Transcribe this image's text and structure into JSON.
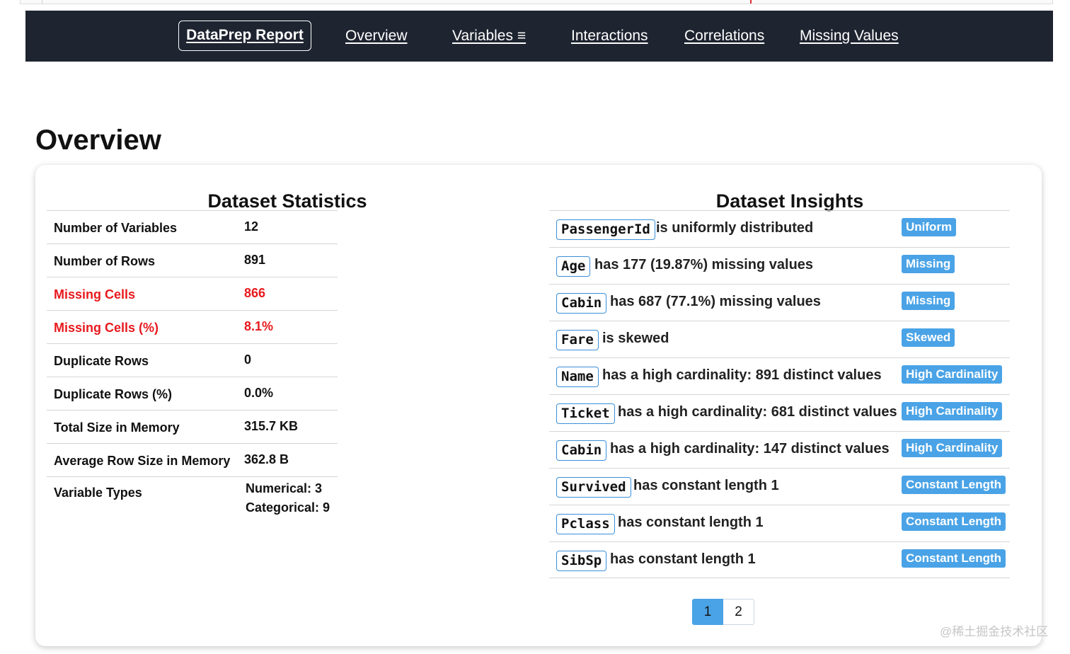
{
  "nav": {
    "brand": "DataPrep Report",
    "links": [
      "Overview",
      "Variables ≡",
      "Interactions",
      "Correlations",
      "Missing Values"
    ]
  },
  "page_title": "Overview",
  "stats": {
    "title": "Dataset Statistics",
    "rows": [
      {
        "label": "Number of Variables",
        "value": "12"
      },
      {
        "label": "Number of Rows",
        "value": "891"
      },
      {
        "label": "Missing Cells",
        "value": "866"
      },
      {
        "label": "Missing Cells (%)",
        "value": "8.1%"
      },
      {
        "label": "Duplicate Rows",
        "value": "0"
      },
      {
        "label": "Duplicate Rows (%)",
        "value": "0.0%"
      },
      {
        "label": "Total Size in Memory",
        "value": "315.7 KB"
      },
      {
        "label": "Average Row Size in Memory",
        "value": "362.8 B"
      }
    ],
    "variable_types": {
      "label": "Variable Types",
      "numerical": "Numerical: 3",
      "categorical": "Categorical: 9"
    },
    "warning_color": "#e8191d"
  },
  "insights": {
    "title": "Dataset Insights",
    "rows": [
      {
        "col": "PassengerId",
        "text": "is uniformly distributed",
        "badge": "Uniform"
      },
      {
        "col": "Age",
        "text": "has 177 (19.87%) missing values",
        "badge": "Missing"
      },
      {
        "col": "Cabin",
        "text": "has 687 (77.1%) missing values",
        "badge": "Missing"
      },
      {
        "col": "Fare",
        "text": "is skewed",
        "badge": "Skewed"
      },
      {
        "col": "Name",
        "text": "has a high cardinality: 891 distinct values",
        "badge": "High Cardinality"
      },
      {
        "col": "Ticket",
        "text": "has a high cardinality: 681 distinct values",
        "badge": "High Cardinality"
      },
      {
        "col": "Cabin",
        "text": "has a high cardinality: 147 distinct values",
        "badge": "High Cardinality"
      },
      {
        "col": "Survived",
        "text": "has constant length 1",
        "badge": "Constant Length"
      },
      {
        "col": "Pclass",
        "text": "has constant length 1",
        "badge": "Constant Length"
      },
      {
        "col": "SibSp",
        "text": "has constant length 1",
        "badge": "Constant Length"
      }
    ],
    "badge_color": "#4aa3e6"
  },
  "pagination": {
    "pages": [
      "1",
      "2"
    ],
    "active": "1"
  },
  "watermark": "@稀土掘金技术社区"
}
